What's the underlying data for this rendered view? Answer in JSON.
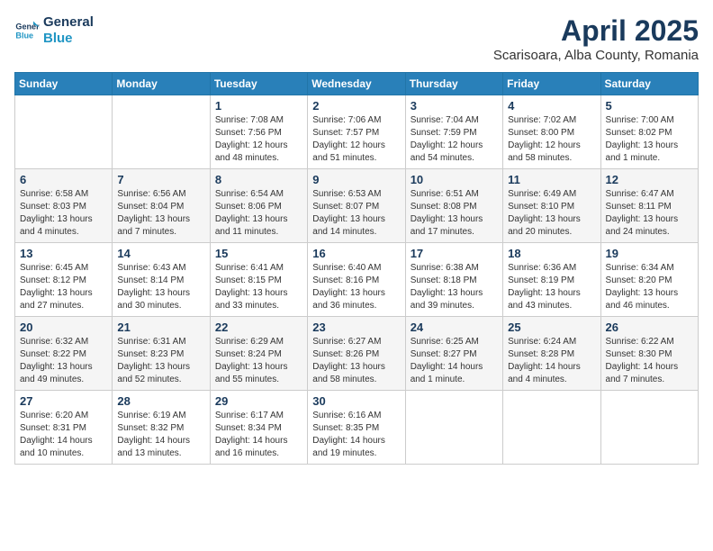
{
  "logo": {
    "line1": "General",
    "line2": "Blue"
  },
  "title": "April 2025",
  "location": "Scarisoara, Alba County, Romania",
  "weekdays": [
    "Sunday",
    "Monday",
    "Tuesday",
    "Wednesday",
    "Thursday",
    "Friday",
    "Saturday"
  ],
  "weeks": [
    [
      {
        "day": "",
        "info": ""
      },
      {
        "day": "",
        "info": ""
      },
      {
        "day": "1",
        "info": "Sunrise: 7:08 AM\nSunset: 7:56 PM\nDaylight: 12 hours and 48 minutes."
      },
      {
        "day": "2",
        "info": "Sunrise: 7:06 AM\nSunset: 7:57 PM\nDaylight: 12 hours and 51 minutes."
      },
      {
        "day": "3",
        "info": "Sunrise: 7:04 AM\nSunset: 7:59 PM\nDaylight: 12 hours and 54 minutes."
      },
      {
        "day": "4",
        "info": "Sunrise: 7:02 AM\nSunset: 8:00 PM\nDaylight: 12 hours and 58 minutes."
      },
      {
        "day": "5",
        "info": "Sunrise: 7:00 AM\nSunset: 8:02 PM\nDaylight: 13 hours and 1 minute."
      }
    ],
    [
      {
        "day": "6",
        "info": "Sunrise: 6:58 AM\nSunset: 8:03 PM\nDaylight: 13 hours and 4 minutes."
      },
      {
        "day": "7",
        "info": "Sunrise: 6:56 AM\nSunset: 8:04 PM\nDaylight: 13 hours and 7 minutes."
      },
      {
        "day": "8",
        "info": "Sunrise: 6:54 AM\nSunset: 8:06 PM\nDaylight: 13 hours and 11 minutes."
      },
      {
        "day": "9",
        "info": "Sunrise: 6:53 AM\nSunset: 8:07 PM\nDaylight: 13 hours and 14 minutes."
      },
      {
        "day": "10",
        "info": "Sunrise: 6:51 AM\nSunset: 8:08 PM\nDaylight: 13 hours and 17 minutes."
      },
      {
        "day": "11",
        "info": "Sunrise: 6:49 AM\nSunset: 8:10 PM\nDaylight: 13 hours and 20 minutes."
      },
      {
        "day": "12",
        "info": "Sunrise: 6:47 AM\nSunset: 8:11 PM\nDaylight: 13 hours and 24 minutes."
      }
    ],
    [
      {
        "day": "13",
        "info": "Sunrise: 6:45 AM\nSunset: 8:12 PM\nDaylight: 13 hours and 27 minutes."
      },
      {
        "day": "14",
        "info": "Sunrise: 6:43 AM\nSunset: 8:14 PM\nDaylight: 13 hours and 30 minutes."
      },
      {
        "day": "15",
        "info": "Sunrise: 6:41 AM\nSunset: 8:15 PM\nDaylight: 13 hours and 33 minutes."
      },
      {
        "day": "16",
        "info": "Sunrise: 6:40 AM\nSunset: 8:16 PM\nDaylight: 13 hours and 36 minutes."
      },
      {
        "day": "17",
        "info": "Sunrise: 6:38 AM\nSunset: 8:18 PM\nDaylight: 13 hours and 39 minutes."
      },
      {
        "day": "18",
        "info": "Sunrise: 6:36 AM\nSunset: 8:19 PM\nDaylight: 13 hours and 43 minutes."
      },
      {
        "day": "19",
        "info": "Sunrise: 6:34 AM\nSunset: 8:20 PM\nDaylight: 13 hours and 46 minutes."
      }
    ],
    [
      {
        "day": "20",
        "info": "Sunrise: 6:32 AM\nSunset: 8:22 PM\nDaylight: 13 hours and 49 minutes."
      },
      {
        "day": "21",
        "info": "Sunrise: 6:31 AM\nSunset: 8:23 PM\nDaylight: 13 hours and 52 minutes."
      },
      {
        "day": "22",
        "info": "Sunrise: 6:29 AM\nSunset: 8:24 PM\nDaylight: 13 hours and 55 minutes."
      },
      {
        "day": "23",
        "info": "Sunrise: 6:27 AM\nSunset: 8:26 PM\nDaylight: 13 hours and 58 minutes."
      },
      {
        "day": "24",
        "info": "Sunrise: 6:25 AM\nSunset: 8:27 PM\nDaylight: 14 hours and 1 minute."
      },
      {
        "day": "25",
        "info": "Sunrise: 6:24 AM\nSunset: 8:28 PM\nDaylight: 14 hours and 4 minutes."
      },
      {
        "day": "26",
        "info": "Sunrise: 6:22 AM\nSunset: 8:30 PM\nDaylight: 14 hours and 7 minutes."
      }
    ],
    [
      {
        "day": "27",
        "info": "Sunrise: 6:20 AM\nSunset: 8:31 PM\nDaylight: 14 hours and 10 minutes."
      },
      {
        "day": "28",
        "info": "Sunrise: 6:19 AM\nSunset: 8:32 PM\nDaylight: 14 hours and 13 minutes."
      },
      {
        "day": "29",
        "info": "Sunrise: 6:17 AM\nSunset: 8:34 PM\nDaylight: 14 hours and 16 minutes."
      },
      {
        "day": "30",
        "info": "Sunrise: 6:16 AM\nSunset: 8:35 PM\nDaylight: 14 hours and 19 minutes."
      },
      {
        "day": "",
        "info": ""
      },
      {
        "day": "",
        "info": ""
      },
      {
        "day": "",
        "info": ""
      }
    ]
  ]
}
